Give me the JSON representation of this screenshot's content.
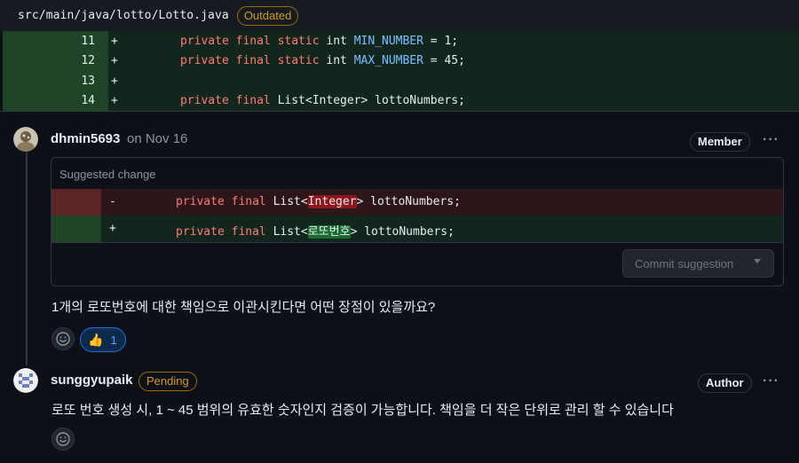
{
  "file": {
    "path": "src/main/java/lotto/Lotto.java",
    "status_badge": "Outdated"
  },
  "diff_lines": [
    {
      "line": "11",
      "sign": "+",
      "kw": "private final static",
      "type": " int ",
      "const": "MIN_NUMBER",
      "rest": " = 1;"
    },
    {
      "line": "12",
      "sign": "+",
      "kw": "private final static",
      "type": " int ",
      "const": "MAX_NUMBER",
      "rest": " = 45;"
    },
    {
      "line": "13",
      "sign": "+",
      "kw": "",
      "type": "",
      "const": "",
      "rest": ""
    },
    {
      "line": "14",
      "sign": "+",
      "kw": "private final",
      "type": " List<Integer> lottoNumbers;",
      "const": "",
      "rest": ""
    }
  ],
  "comments": [
    {
      "username": "dhmin5693",
      "timestamp": "on Nov 16",
      "role": "Member",
      "suggestion": {
        "title": "Suggested change",
        "removed": {
          "sign": "-",
          "kw": "private final",
          "before": " List<",
          "highlight": "Integer",
          "after": "> lottoNumbers;"
        },
        "added": {
          "sign": "+",
          "kw": "private final",
          "before": " List<",
          "highlight": "로또번호",
          "after": "> lottoNumbers;"
        },
        "commit_label": "Commit suggestion"
      },
      "body": "1개의 로또번호에 대한 책임으로 이관시킨다면 어떤 장점이 있을까요?",
      "reaction": {
        "emoji": "👍",
        "count": "1"
      }
    },
    {
      "username": "sunggyupaik",
      "pending_badge": "Pending",
      "role": "Author",
      "body": "로또 번호 생성 시, 1 ~ 45 범위의 유효한 숫자인지 검증이 가능합니다. 책임을 더 작은 단위로 관리 할 수 있습니다"
    }
  ],
  "icons": {
    "more": "kebab-horizontal-icon",
    "emoji": "smiley-icon",
    "dropdown": "triangle-down-icon"
  },
  "colors": {
    "background": "#0d1117",
    "added_bg": "#12261e",
    "removed_bg": "#2d1619",
    "outdated": "#d29922",
    "accent": "#1f6feb"
  }
}
